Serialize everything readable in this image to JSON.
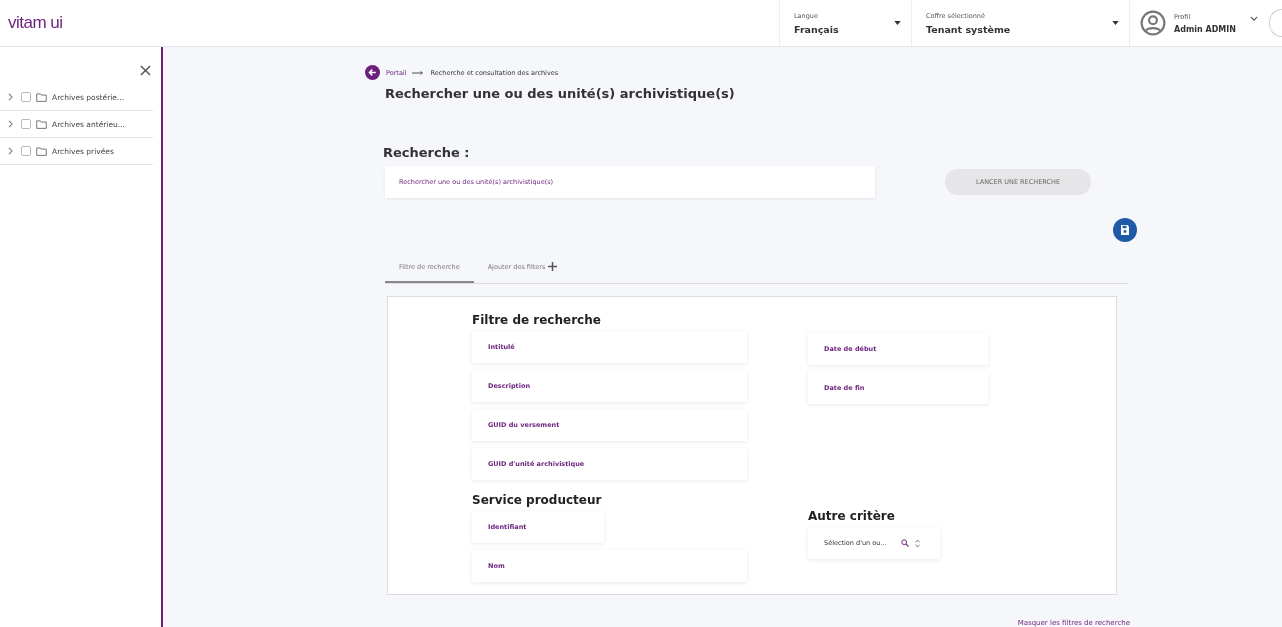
{
  "header": {
    "logo": "vitam ui",
    "selects": [
      {
        "label": "Langue",
        "value": "Français"
      },
      {
        "label": "Coffre sélectionné",
        "value": "Tenant système"
      }
    ],
    "profile": {
      "label": "Profil",
      "value": "Admin ADMIN"
    }
  },
  "sidebar": {
    "items": [
      {
        "label": "Archives postérie...",
        "checked": false,
        "expanded": false
      },
      {
        "label": "Archives antérieu...",
        "checked": false,
        "expanded": false
      },
      {
        "label": "Archives privées",
        "checked": false,
        "expanded": false
      }
    ]
  },
  "breadcrumb": [
    "Portail",
    "Recherche et consultation des archives"
  ],
  "title": "Rechercher une ou des unité(s) archivistique(s)",
  "search": {
    "heading": "Recherche :",
    "placeholder": "Rechercher une ou des unité(s) archivistique(s)",
    "button": "LANCER UNE RECHERCHE"
  },
  "tabs": [
    {
      "label": "Filtre de recherche",
      "selected": true
    },
    {
      "label": "Ajouter des filters",
      "selected": false
    }
  ],
  "filters": {
    "heading": "Filtre de recherche",
    "fields": [
      {
        "placeholder": "Intitulé"
      },
      {
        "placeholder": "Description"
      },
      {
        "placeholder": "GUID du versement"
      },
      {
        "placeholder": "GUID d'unité archivistique"
      }
    ],
    "dates": [
      {
        "placeholder": "Date de début"
      },
      {
        "placeholder": "Date de fin"
      }
    ]
  },
  "producer": {
    "heading": "Service producteur",
    "fields": [
      {
        "placeholder": "Identifiant",
        "kind": "short"
      },
      {
        "placeholder": "Nom",
        "kind": "long"
      }
    ]
  },
  "other": {
    "heading": "Autre critère",
    "value": "Sélection d'un ou..."
  },
  "footer_link": "Masquer les filtres de recherche"
}
